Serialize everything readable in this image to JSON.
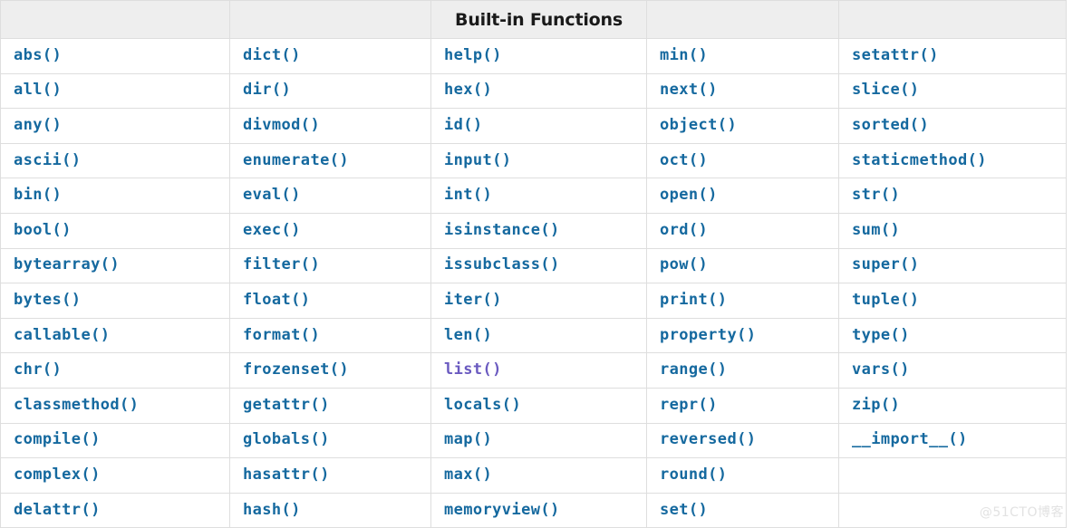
{
  "table": {
    "title": "Built-in Functions",
    "title_column_index": 2,
    "colors": {
      "link": "#15699f",
      "visited_link": "#6a5ac0",
      "header_background": "#eeeeee",
      "border": "#dedede",
      "cell_background": "#ffffff",
      "title_text": "#1a1a1a",
      "watermark_text": "#e2e2e2"
    },
    "header_cells": [
      "",
      "",
      "Built-in Functions",
      "",
      ""
    ],
    "columns": [
      {
        "index": 0,
        "items": [
          "abs()",
          "all()",
          "any()",
          "ascii()",
          "bin()",
          "bool()",
          "bytearray()",
          "bytes()",
          "callable()",
          "chr()",
          "classmethod()",
          "compile()",
          "complex()",
          "delattr()"
        ]
      },
      {
        "index": 1,
        "items": [
          "dict()",
          "dir()",
          "divmod()",
          "enumerate()",
          "eval()",
          "exec()",
          "filter()",
          "float()",
          "format()",
          "frozenset()",
          "getattr()",
          "globals()",
          "hasattr()",
          "hash()"
        ]
      },
      {
        "index": 2,
        "items": [
          "help()",
          "hex()",
          "id()",
          "input()",
          "int()",
          "isinstance()",
          "issubclass()",
          "iter()",
          "len()",
          "list()",
          "locals()",
          "map()",
          "max()",
          "memoryview()"
        ]
      },
      {
        "index": 3,
        "items": [
          "min()",
          "next()",
          "object()",
          "oct()",
          "open()",
          "ord()",
          "pow()",
          "print()",
          "property()",
          "range()",
          "repr()",
          "reversed()",
          "round()",
          "set()"
        ]
      },
      {
        "index": 4,
        "items": [
          "setattr()",
          "slice()",
          "sorted()",
          "staticmethod()",
          "str()",
          "sum()",
          "super()",
          "tuple()",
          "type()",
          "vars()",
          "zip()",
          "__import__()",
          "",
          ""
        ]
      }
    ],
    "visited_items": [
      "list()"
    ],
    "row_count": 14,
    "column_count": 5
  },
  "watermark": {
    "text": "@51CTO博客"
  }
}
